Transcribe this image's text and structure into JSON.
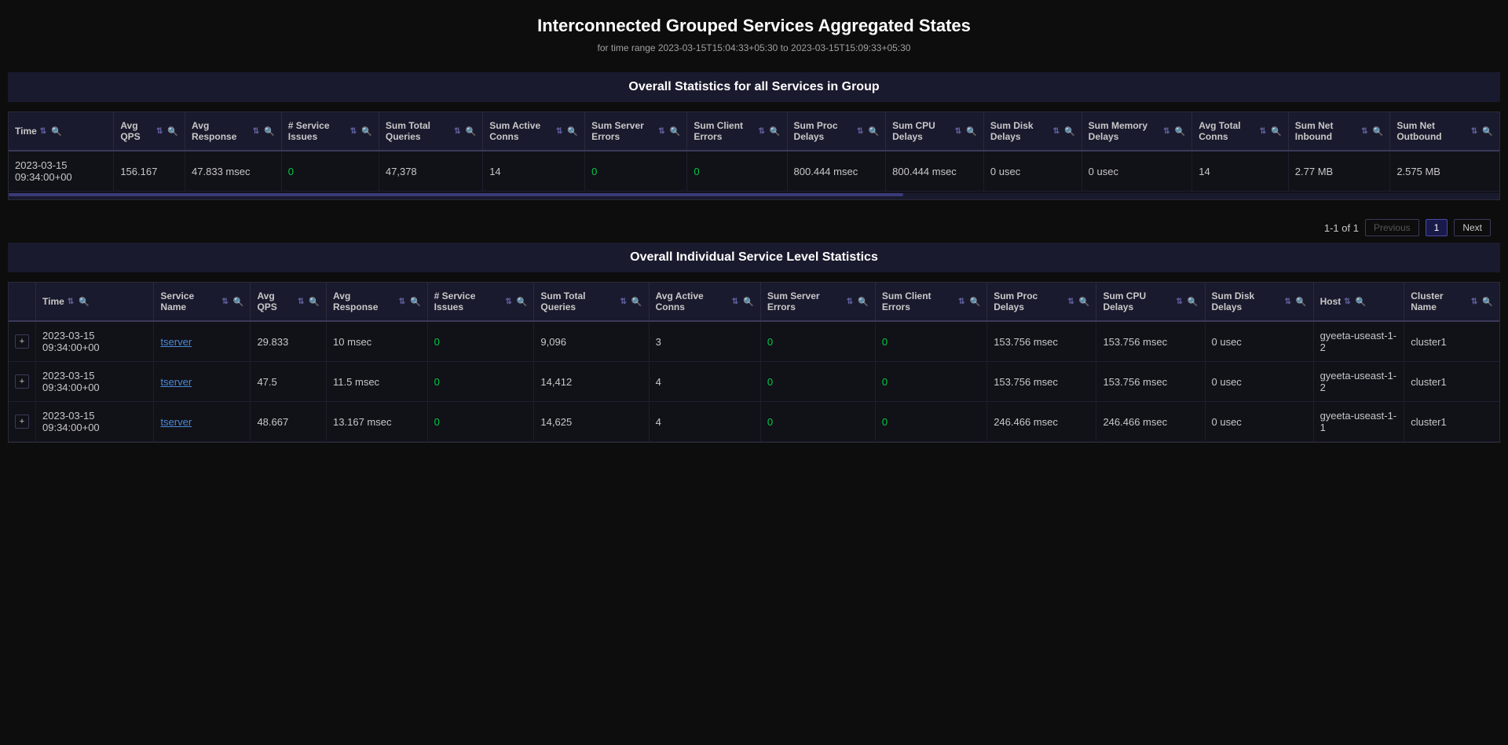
{
  "page": {
    "title": "Interconnected Grouped Services Aggregated States",
    "subtitle": "for time range 2023-03-15T15:04:33+05:30 to 2023-03-15T15:09:33+05:30"
  },
  "section1": {
    "title": "Overall Statistics for all Services in Group",
    "columns": [
      "Time",
      "Avg QPS",
      "Avg Response",
      "# Service Issues",
      "Sum Total Queries",
      "Sum Active Conns",
      "Sum Server Errors",
      "Sum Client Errors",
      "Sum Proc Delays",
      "Sum CPU Delays",
      "Sum Disk Delays",
      "Sum Memory Delays",
      "Avg Total Conns",
      "Sum Net Inbound",
      "Sum Net Outbound"
    ],
    "rows": [
      {
        "time": "2023-03-15 09:34:00+00",
        "avg_qps": "156.167",
        "avg_response": "47.833 msec",
        "service_issues": "0",
        "total_queries": "47,378",
        "active_conns": "14",
        "server_errors": "0",
        "client_errors": "0",
        "proc_delays": "800.444 msec",
        "cpu_delays": "800.444 msec",
        "disk_delays": "0 usec",
        "memory_delays": "0 usec",
        "total_conns": "14",
        "net_inbound": "2.77 MB",
        "net_outbound": "2.575 MB"
      }
    ],
    "pagination": {
      "info": "1-1 of 1",
      "prev_label": "Previous",
      "next_label": "Next",
      "current_page": "1"
    }
  },
  "section2": {
    "title": "Overall Individual Service Level Statistics",
    "columns": [
      "Time",
      "Service Name",
      "Avg QPS",
      "Avg Response",
      "# Service Issues",
      "Sum Total Queries",
      "Avg Active Conns",
      "Sum Server Errors",
      "Sum Client Errors",
      "Sum Proc Delays",
      "Sum CPU Delays",
      "Sum Disk Delays",
      "Host",
      "Cluster Name"
    ],
    "rows": [
      {
        "expand": "+",
        "time": "2023-03-15 09:34:00+00",
        "service_name": "tserver",
        "avg_qps": "29.833",
        "avg_response": "10 msec",
        "service_issues": "0",
        "total_queries": "9,096",
        "active_conns": "3",
        "server_errors": "0",
        "client_errors": "0",
        "proc_delays": "153.756 msec",
        "cpu_delays": "153.756 msec",
        "disk_delays": "0 usec",
        "host": "gyeeta-useast-1-2",
        "cluster_name": "cluster1"
      },
      {
        "expand": "+",
        "time": "2023-03-15 09:34:00+00",
        "service_name": "tserver",
        "avg_qps": "47.5",
        "avg_response": "11.5 msec",
        "service_issues": "0",
        "total_queries": "14,412",
        "active_conns": "4",
        "server_errors": "0",
        "client_errors": "0",
        "proc_delays": "153.756 msec",
        "cpu_delays": "153.756 msec",
        "disk_delays": "0 usec",
        "host": "gyeeta-useast-1-2",
        "cluster_name": "cluster1"
      },
      {
        "expand": "+",
        "time": "2023-03-15 09:34:00+00",
        "service_name": "tserver",
        "avg_qps": "48.667",
        "avg_response": "13.167 msec",
        "service_issues": "0",
        "total_queries": "14,625",
        "active_conns": "4",
        "server_errors": "0",
        "client_errors": "0",
        "proc_delays": "246.466 msec",
        "cpu_delays": "246.466 msec",
        "disk_delays": "0 usec",
        "host": "gyeeta-useast-1-1",
        "cluster_name": "cluster1"
      }
    ]
  },
  "icons": {
    "sort": "⇅",
    "search": "🔍",
    "expand": "+",
    "chevron_up": "↑",
    "chevron_down": "↓"
  }
}
